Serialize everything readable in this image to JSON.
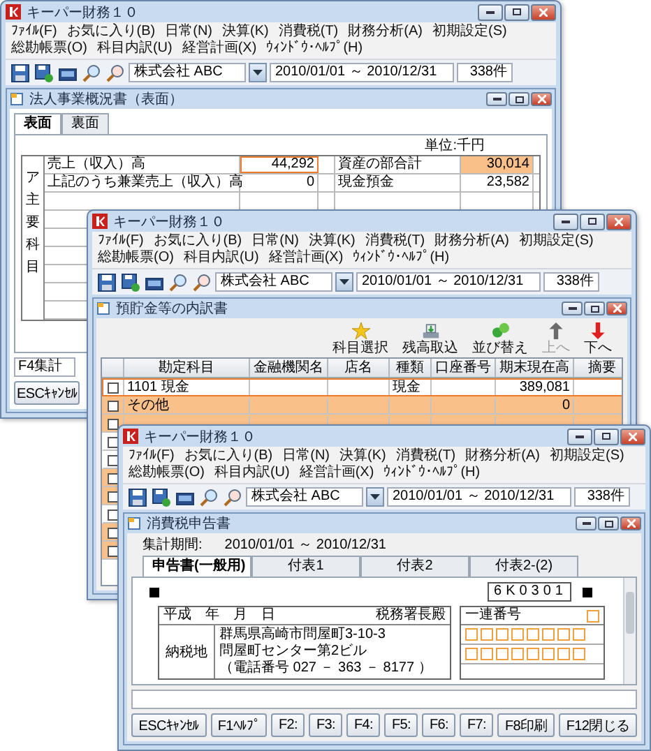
{
  "windows": [
    {
      "kind": "overview",
      "title": "キーパー財務１０",
      "menu": [
        "ﾌｧｲﾙ(F)",
        "お気に入り(B)",
        "日常(N)",
        "決算(K)",
        "消費税(T)",
        "財務分析(A)",
        "初期設定(S)",
        "総勘帳票(O)",
        "科目内訳(U)",
        "経営計画(X)",
        "ｳｨﾝﾄﾞｳ･ﾍﾙﾌﾟ(H)"
      ],
      "company": "株式会社 ABC",
      "period": "2010/01/01 ～ 2010/12/31",
      "count": "338件",
      "child": {
        "title": "法人事業概況書（表面）",
        "tabs": [
          {
            "label": "表面",
            "selected": true
          },
          {
            "label": "裏面",
            "selected": false
          }
        ],
        "unit": "単位:千円",
        "side_label": "ア主要科目",
        "rows": [
          {
            "label": "売上（収入）高",
            "value": "44,292",
            "focused": true,
            "asset_label": "資産の部合計",
            "asset_value": "30,014",
            "asset_highlight": true
          },
          {
            "label": "上記のうち兼業売上（収入）高",
            "value": "0",
            "focused": false,
            "asset_label": "現金預金",
            "asset_value": "23,582",
            "asset_highlight": false
          }
        ],
        "status": "F4集計",
        "buttons": [
          "ESCｷｬﾝｾﾙ"
        ]
      }
    },
    {
      "kind": "breakdown",
      "title": "キーパー財務１０",
      "menu": [
        "ﾌｧｲﾙ(F)",
        "お気に入り(B)",
        "日常(N)",
        "決算(K)",
        "消費税(T)",
        "財務分析(A)",
        "初期設定(S)",
        "総勘帳票(O)",
        "科目内訳(U)",
        "経営計画(X)",
        "ｳｨﾝﾄﾞｳ･ﾍﾙﾌﾟ(H)"
      ],
      "company": "株式会社 ABC",
      "period": "2010/01/01 ～ 2010/12/31",
      "count": "338件",
      "child": {
        "title": "預貯金等の内訳書",
        "tools": [
          {
            "kind": "star",
            "label": "科目選択",
            "disabled": false
          },
          {
            "kind": "import",
            "label": "残高取込",
            "disabled": false
          },
          {
            "kind": "sort",
            "label": "並び替え",
            "disabled": false
          },
          {
            "kind": "up",
            "label": "上へ",
            "disabled": true
          },
          {
            "kind": "down",
            "label": "下へ",
            "disabled": false
          }
        ],
        "columns": [
          "勘定科目",
          "金融機関名",
          "店名",
          "種類",
          "口座番号",
          "期末現在高",
          "摘要"
        ],
        "rows": [
          {
            "kind": "account",
            "selected": true,
            "checked": false,
            "account": "1101 現金",
            "type": "現金",
            "balance": "389,081"
          },
          {
            "kind": "other",
            "selected": false,
            "checked": false,
            "account": "その他",
            "balance": "0"
          },
          {
            "kind": "subtotal",
            "selected": false,
            "checked": false
          },
          {
            "kind": "account",
            "selected": false,
            "checked": false
          },
          {
            "kind": "account",
            "selected": false,
            "checked": false
          },
          {
            "kind": "other",
            "selected": false,
            "checked": false
          },
          {
            "kind": "subtotal",
            "selected": false,
            "checked": false
          },
          {
            "kind": "account",
            "selected": false,
            "checked": false
          },
          {
            "kind": "other",
            "selected": false,
            "checked": false
          },
          {
            "kind": "subtotal",
            "selected": false,
            "checked": false
          }
        ]
      }
    },
    {
      "kind": "taxreturn",
      "title": "キーパー財務１０",
      "menu": [
        "ﾌｧｲﾙ(F)",
        "お気に入り(B)",
        "日常(N)",
        "決算(K)",
        "消費税(T)",
        "財務分析(A)",
        "初期設定(S)",
        "総勘帳票(O)",
        "科目内訳(U)",
        "経営計画(X)",
        "ｳｨﾝﾄﾞｳ･ﾍﾙﾌﾟ(H)"
      ],
      "company": "株式会社 ABC",
      "period": "2010/01/01 ～ 2010/12/31",
      "count": "338件",
      "child": {
        "title": "消費税申告書",
        "period_label": "集計期間:",
        "period": "2010/01/01 ～ 2010/12/31",
        "tabs": [
          {
            "label": "申告書(一般用)",
            "selected": true
          },
          {
            "label": "付表1",
            "selected": false
          },
          {
            "label": "付表2",
            "selected": false
          },
          {
            "label": "付表2-(2)",
            "selected": false
          }
        ],
        "form": {
          "code": "6K0301",
          "date": "平成　年　月　日",
          "office": "税務署長殿",
          "serial": "一連番号",
          "address_label": "納税地",
          "address": [
            "群馬県高崎市問屋町3-10-3",
            "問屋町センター第2ビル"
          ],
          "phone": "（電話番号 027 － 363 － 8177 ）"
        },
        "buttons": [
          "ESCｷｬﾝｾﾙ",
          "F1ﾍﾙﾌﾟ",
          "F2:",
          "F3:",
          "F4:",
          "F5:",
          "F6:",
          "F7:",
          "F8印刷",
          "F12閉じる"
        ]
      }
    }
  ]
}
